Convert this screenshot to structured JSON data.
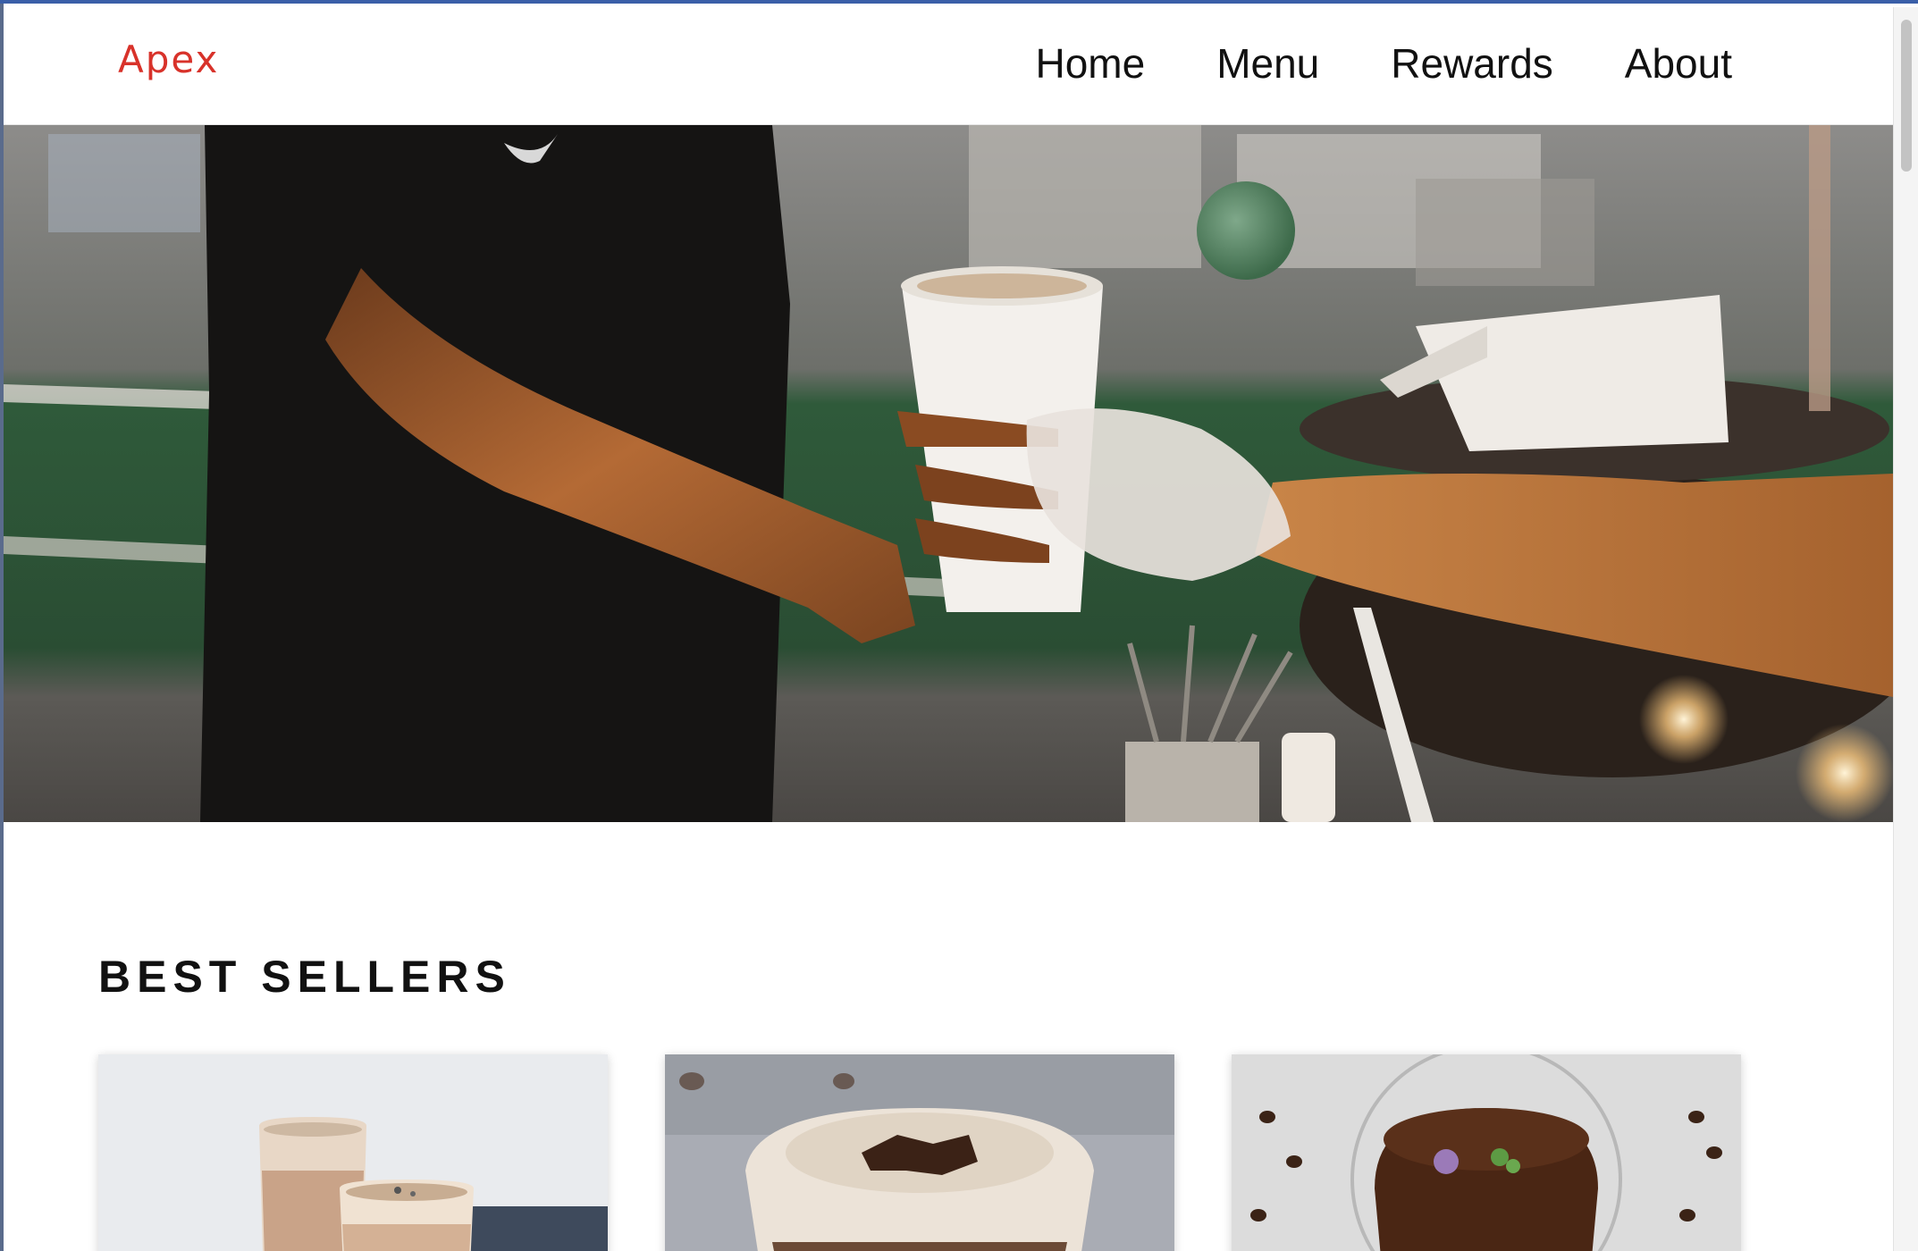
{
  "brand": {
    "name": "Apex",
    "color": "#d8322a"
  },
  "nav": {
    "items": [
      {
        "label": "Home"
      },
      {
        "label": "Menu"
      },
      {
        "label": "Rewards"
      },
      {
        "label": "About"
      }
    ]
  },
  "hero": {
    "image": "hero-photo-handing-coffee-cup"
  },
  "best_sellers": {
    "title": "BEST SELLERS",
    "cards": [
      {
        "image": "two-smoothies-photo"
      },
      {
        "image": "chocolate-shake-photo"
      },
      {
        "image": "chocolate-pudding-glass-photo"
      }
    ]
  }
}
